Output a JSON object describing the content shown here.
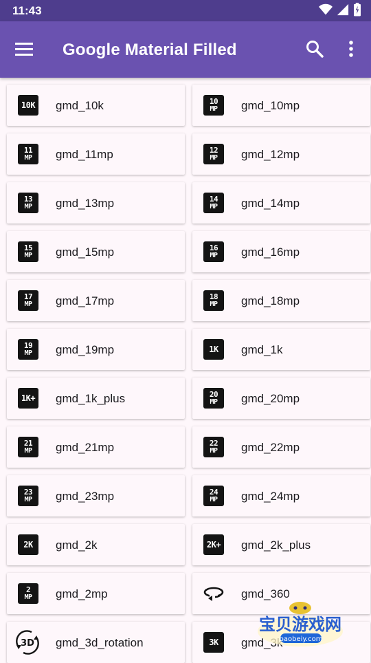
{
  "status": {
    "time": "11:43"
  },
  "appbar": {
    "title": "Google Material Filled"
  },
  "icons": [
    {
      "label": "gmd_10k",
      "top": "10K",
      "bottom": "",
      "type": "badge"
    },
    {
      "label": "gmd_10mp",
      "top": "10",
      "bottom": "MP",
      "type": "badge"
    },
    {
      "label": "gmd_11mp",
      "top": "11",
      "bottom": "MP",
      "type": "badge"
    },
    {
      "label": "gmd_12mp",
      "top": "12",
      "bottom": "MP",
      "type": "badge"
    },
    {
      "label": "gmd_13mp",
      "top": "13",
      "bottom": "MP",
      "type": "badge"
    },
    {
      "label": "gmd_14mp",
      "top": "14",
      "bottom": "MP",
      "type": "badge"
    },
    {
      "label": "gmd_15mp",
      "top": "15",
      "bottom": "MP",
      "type": "badge"
    },
    {
      "label": "gmd_16mp",
      "top": "16",
      "bottom": "MP",
      "type": "badge"
    },
    {
      "label": "gmd_17mp",
      "top": "17",
      "bottom": "MP",
      "type": "badge"
    },
    {
      "label": "gmd_18mp",
      "top": "18",
      "bottom": "MP",
      "type": "badge"
    },
    {
      "label": "gmd_19mp",
      "top": "19",
      "bottom": "MP",
      "type": "badge"
    },
    {
      "label": "gmd_1k",
      "top": "1K",
      "bottom": "",
      "type": "badge"
    },
    {
      "label": "gmd_1k_plus",
      "top": "1K+",
      "bottom": "",
      "type": "badge"
    },
    {
      "label": "gmd_20mp",
      "top": "20",
      "bottom": "MP",
      "type": "badge"
    },
    {
      "label": "gmd_21mp",
      "top": "21",
      "bottom": "MP",
      "type": "badge"
    },
    {
      "label": "gmd_22mp",
      "top": "22",
      "bottom": "MP",
      "type": "badge"
    },
    {
      "label": "gmd_23mp",
      "top": "23",
      "bottom": "MP",
      "type": "badge"
    },
    {
      "label": "gmd_24mp",
      "top": "24",
      "bottom": "MP",
      "type": "badge"
    },
    {
      "label": "gmd_2k",
      "top": "2K",
      "bottom": "",
      "type": "badge"
    },
    {
      "label": "gmd_2k_plus",
      "top": "2K+",
      "bottom": "",
      "type": "badge"
    },
    {
      "label": "gmd_2mp",
      "top": "2",
      "bottom": "MP",
      "type": "badge"
    },
    {
      "label": "gmd_360",
      "top": "",
      "bottom": "",
      "type": "rotate-360"
    },
    {
      "label": "gmd_3d_rotation",
      "top": "3D",
      "bottom": "",
      "type": "rotate-3d"
    },
    {
      "label": "gmd_3k",
      "top": "3K",
      "bottom": "",
      "type": "badge"
    }
  ],
  "watermark": {
    "text": "宝贝游戏网",
    "url": "baobeiy.com"
  },
  "colors": {
    "statusbar": "#4e3d8d",
    "appbar": "#6a52b0",
    "background": "#fef7fb"
  }
}
